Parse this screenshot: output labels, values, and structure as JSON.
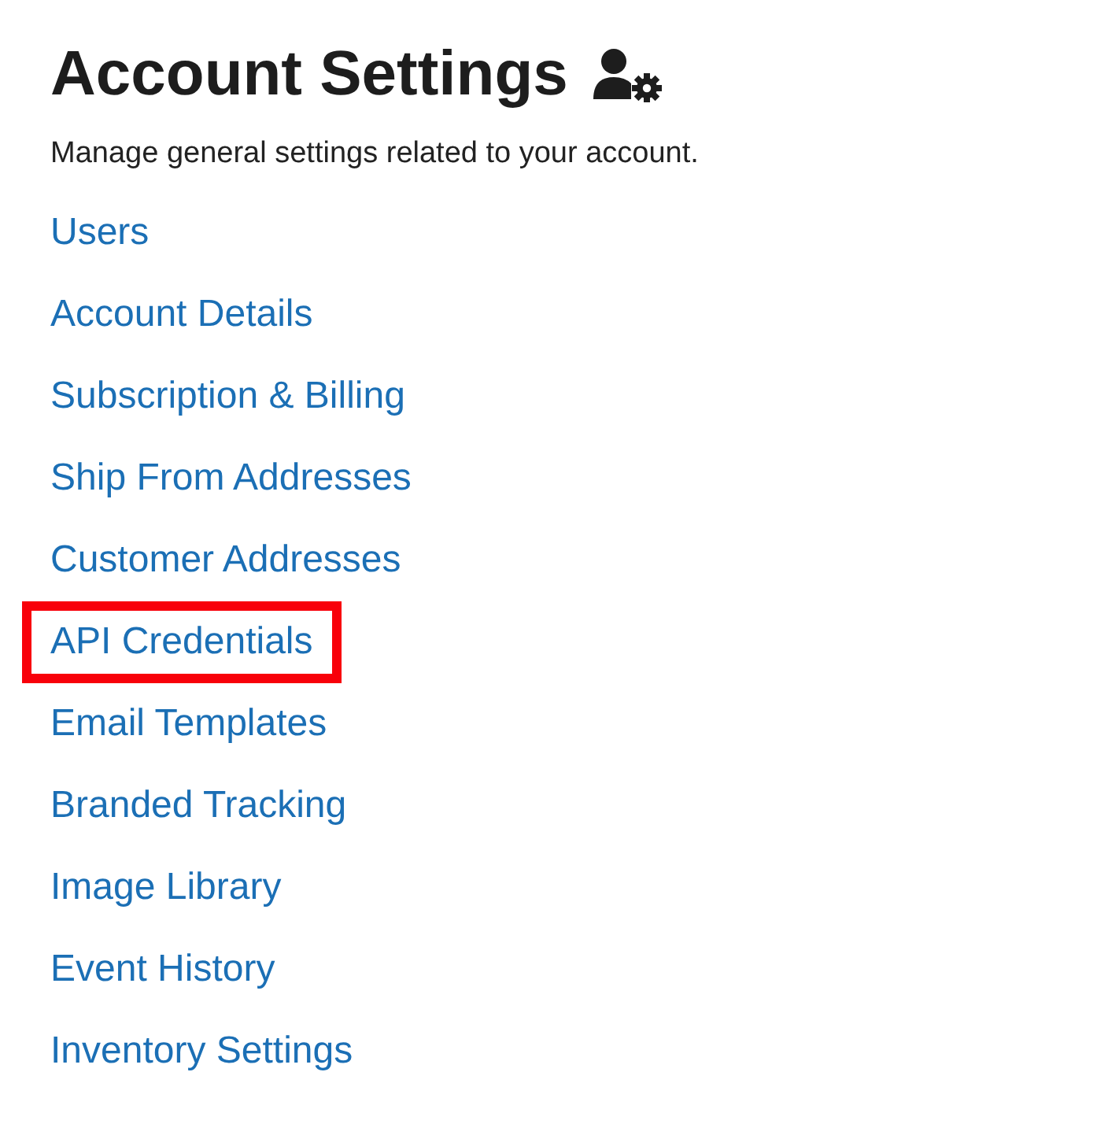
{
  "header": {
    "title": "Account Settings",
    "description": "Manage general settings related to your account."
  },
  "links": [
    {
      "label": "Users",
      "highlighted": false
    },
    {
      "label": "Account Details",
      "highlighted": false
    },
    {
      "label": "Subscription & Billing",
      "highlighted": false
    },
    {
      "label": "Ship From Addresses",
      "highlighted": false
    },
    {
      "label": "Customer Addresses",
      "highlighted": false
    },
    {
      "label": "API Credentials",
      "highlighted": true
    },
    {
      "label": "Email Templates",
      "highlighted": false
    },
    {
      "label": "Branded Tracking",
      "highlighted": false
    },
    {
      "label": "Image Library",
      "highlighted": false
    },
    {
      "label": "Event History",
      "highlighted": false
    },
    {
      "label": "Inventory Settings",
      "highlighted": false
    }
  ]
}
